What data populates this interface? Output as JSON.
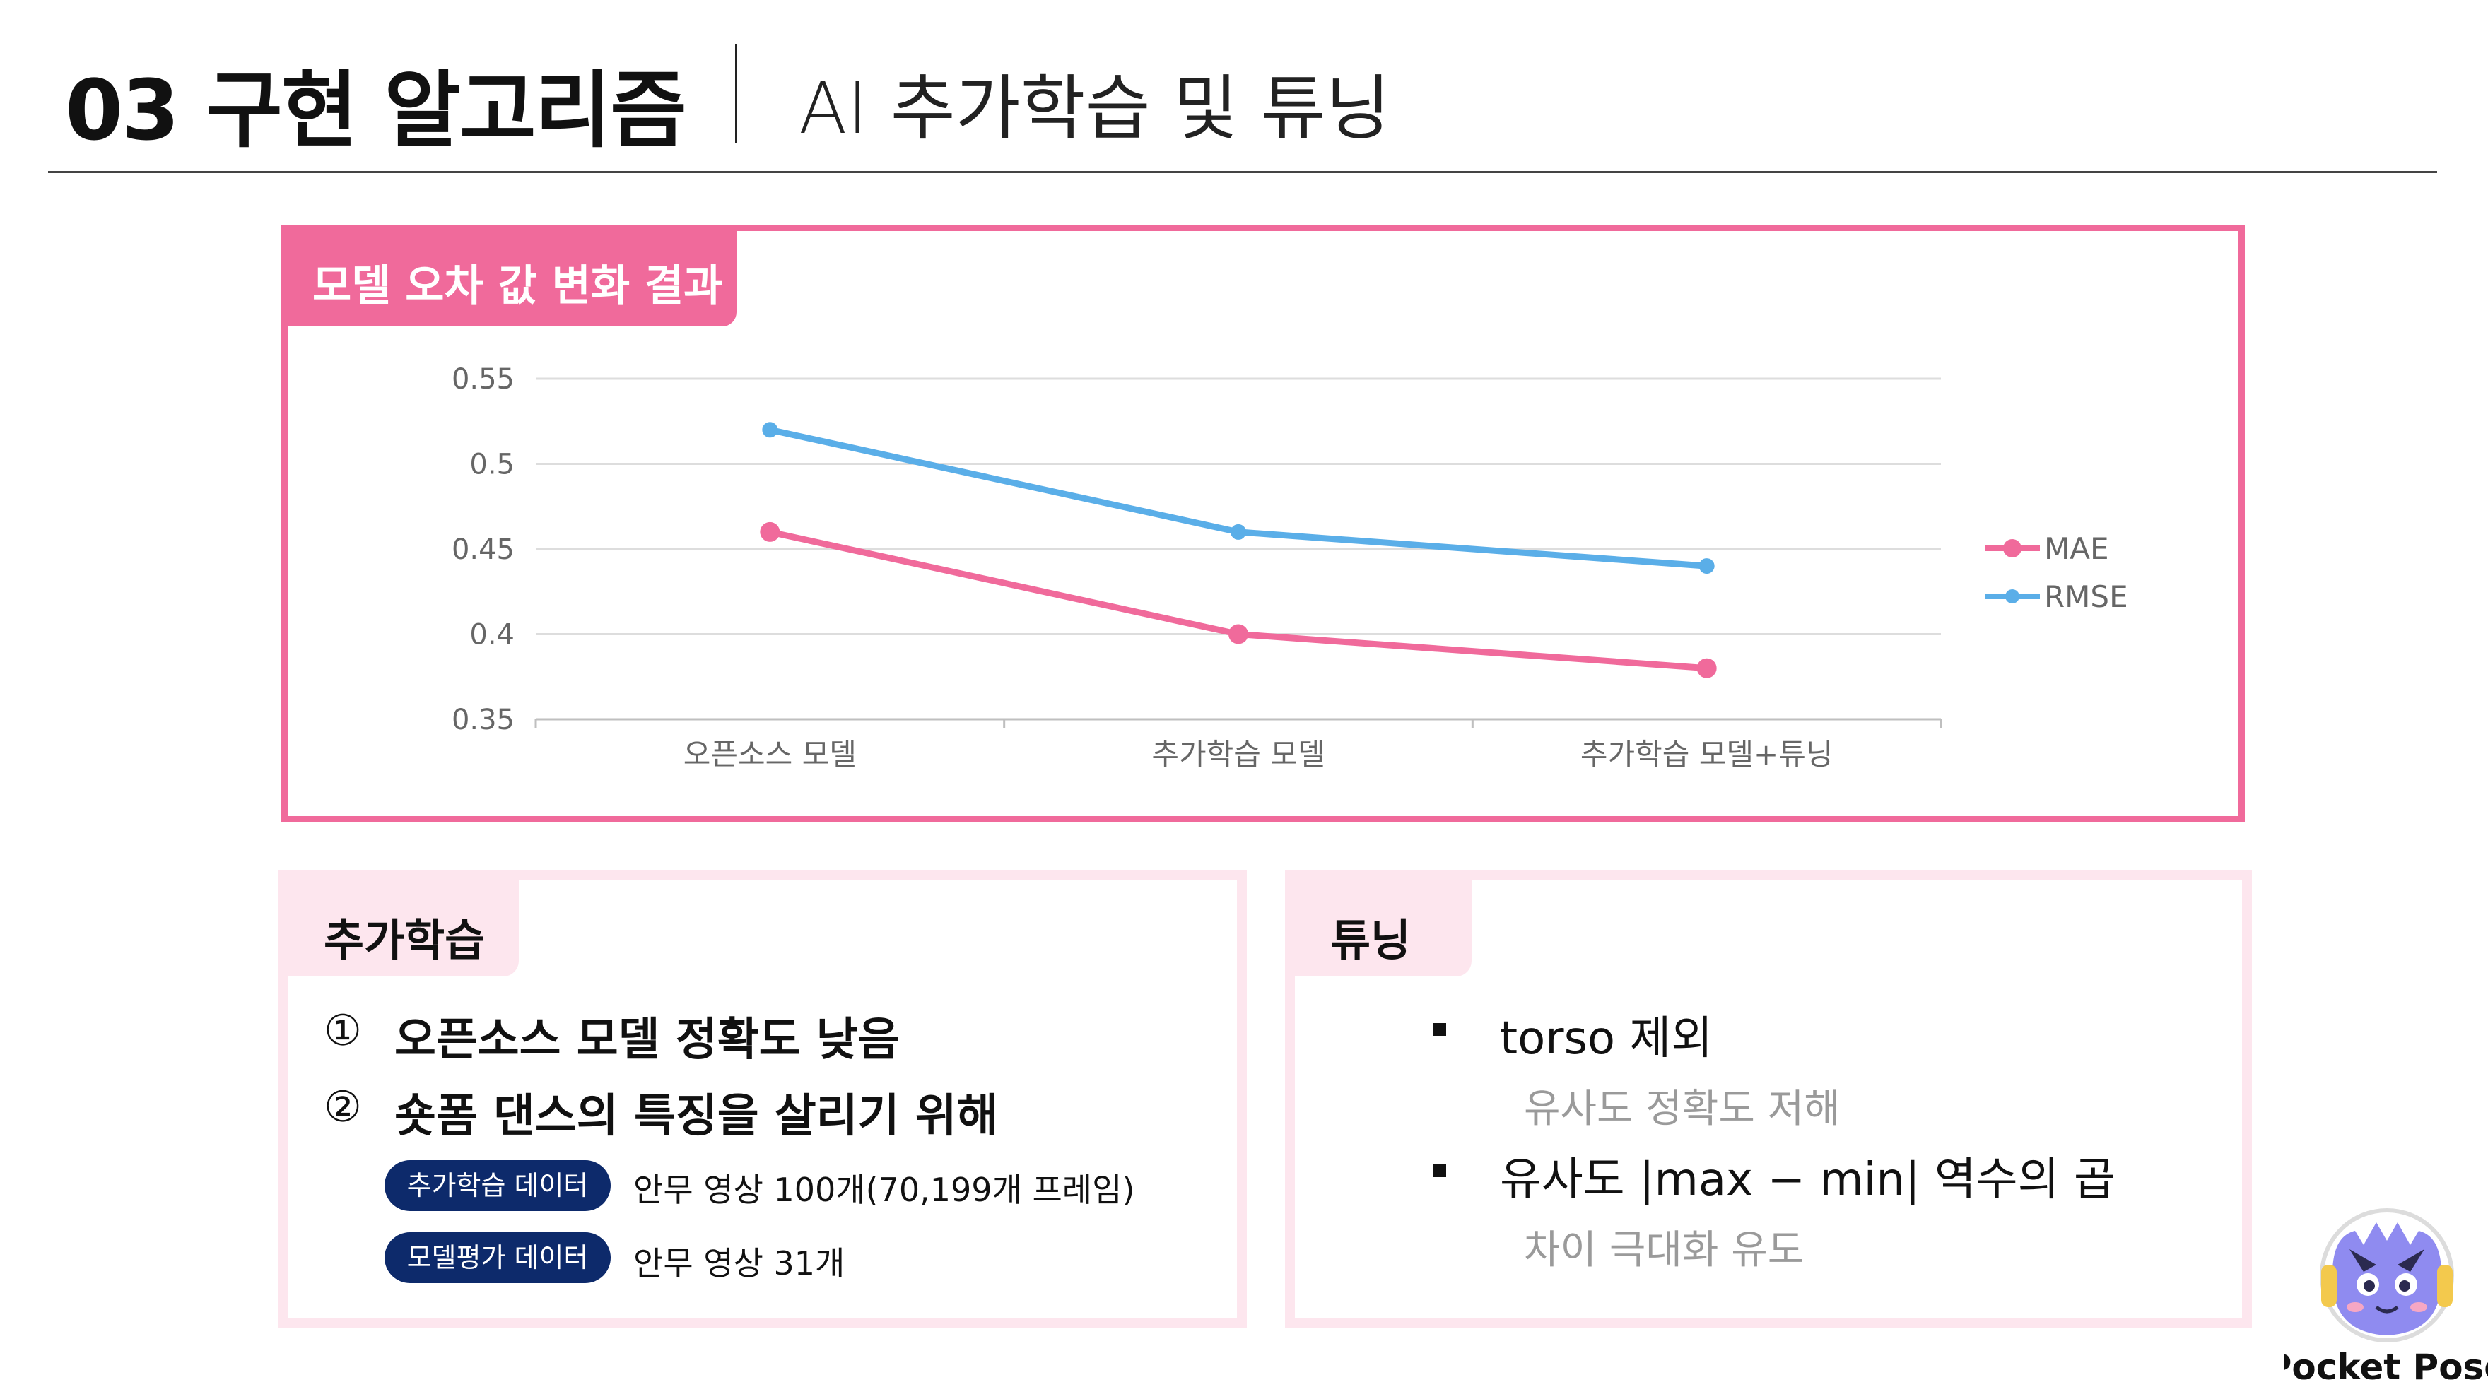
{
  "header": {
    "title": "03 구현 알고리즘",
    "subtitle": "AI 추가학습 및 튜닝"
  },
  "chart_section": {
    "tag": "모델 오차 값 변화 결과"
  },
  "chart_data": {
    "type": "line",
    "categories": [
      "오픈소스 모델",
      "추가학습 모델",
      "추가학습 모델+튜닝"
    ],
    "series": [
      {
        "name": "MAE",
        "values": [
          0.46,
          0.4,
          0.38
        ],
        "color": "#f06a9b"
      },
      {
        "name": "RMSE",
        "values": [
          0.52,
          0.46,
          0.44
        ],
        "color": "#5aaee8"
      }
    ],
    "yticks": [
      "0.35",
      "0.4",
      "0.45",
      "0.5",
      "0.55"
    ],
    "ylim": [
      0.35,
      0.55
    ],
    "grid": true,
    "legend": "right"
  },
  "left_card": {
    "tag": "추가학습",
    "items": [
      {
        "num": "①",
        "text": "오픈소스 모델 정확도 낮음"
      },
      {
        "num": "②",
        "text": "숏폼 댄스의 특징을 살리기 위해"
      }
    ],
    "data_rows": [
      {
        "pill": "추가학습 데이터",
        "desc": "안무 영상 100개(70,199개 프레임)"
      },
      {
        "pill": "모델평가 데이터",
        "desc": "안무 영상 31개"
      }
    ]
  },
  "right_card": {
    "tag": "튜닝",
    "items": [
      {
        "text": "torso 제외",
        "sub": "유사도 정확도 저해"
      },
      {
        "text": "유사도 |max − min| 역수의 곱",
        "sub": "차이 극대화 유도"
      }
    ]
  },
  "logo": {
    "text": "Pocket Pose"
  }
}
